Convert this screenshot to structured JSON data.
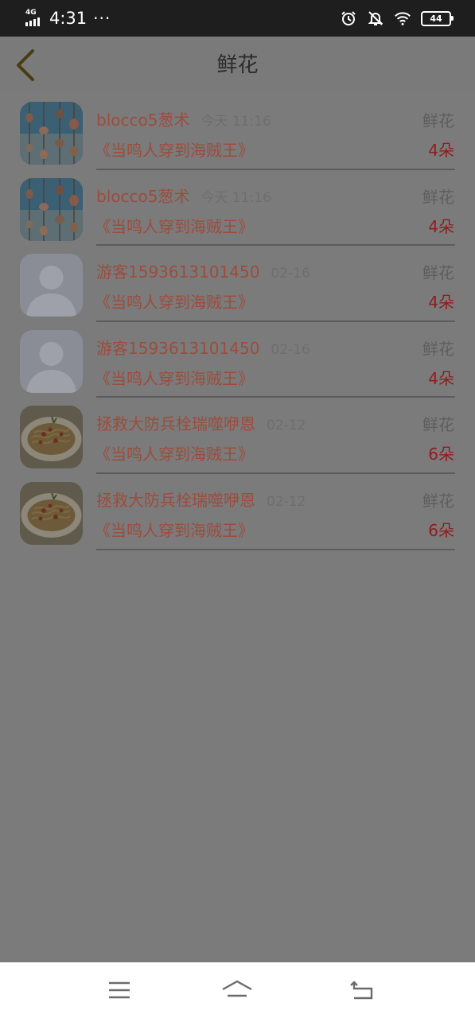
{
  "status_bar": {
    "network": "4G",
    "time": "4:31",
    "more": "···",
    "battery": "44",
    "icons": [
      "alarm-icon",
      "bell-off-icon",
      "wifi-icon",
      "battery-icon"
    ]
  },
  "header": {
    "title": "鲜花",
    "back_icon": "chevron-left-icon"
  },
  "items": [
    {
      "user": "blocco5葱术",
      "time": "今天 11:16",
      "type": "鲜花",
      "book": "《当鸣人穿到海贼王》",
      "count": "4朵",
      "avatar": "seashell-photo"
    },
    {
      "user": "blocco5葱术",
      "time": "今天 11:16",
      "type": "鲜花",
      "book": "《当鸣人穿到海贼王》",
      "count": "4朵",
      "avatar": "seashell-photo"
    },
    {
      "user": "游客1593613101450",
      "time": "02-16",
      "type": "鲜花",
      "book": "《当鸣人穿到海贼王》",
      "count": "4朵",
      "avatar": "default-avatar"
    },
    {
      "user": "游客1593613101450",
      "time": "02-16",
      "type": "鲜花",
      "book": "《当鸣人穿到海贼王》",
      "count": "4朵",
      "avatar": "default-avatar"
    },
    {
      "user": "拯救大防兵栓瑞噬咿恩",
      "time": "02-12",
      "type": "鲜花",
      "book": "《当鸣人穿到海贼王》",
      "count": "6朵",
      "avatar": "pasta-photo"
    },
    {
      "user": "拯救大防兵栓瑞噬咿恩",
      "time": "02-12",
      "type": "鲜花",
      "book": "《当鸣人穿到海贼王》",
      "count": "6朵",
      "avatar": "pasta-photo"
    }
  ],
  "nav": {
    "icons": [
      "menu-icon",
      "home-icon",
      "back-icon"
    ]
  },
  "colors": {
    "overlay": "#7b7b7b",
    "username": "#9c4c3c",
    "count": "#8f1d1d",
    "back_arrow": "#4a3c10"
  }
}
